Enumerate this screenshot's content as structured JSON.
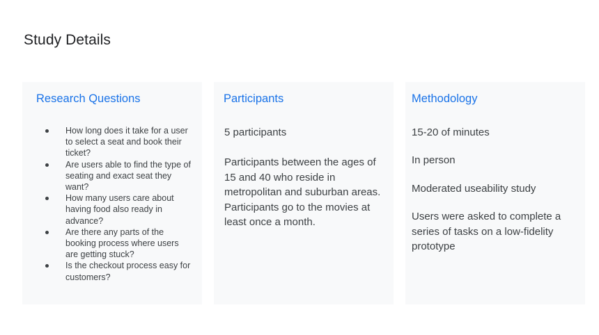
{
  "page": {
    "title": "Study Details"
  },
  "research": {
    "heading": "Research Questions",
    "questions": [
      "How long does it take for a user to select a seat and book their ticket?",
      "Are users able to find the type of seating and exact seat they want?",
      "How many users care about having food also ready in advance?",
      "Are there any parts of the booking process where users are getting stuck?",
      "Is the checkout process easy for customers?"
    ]
  },
  "participants": {
    "heading": "Participants",
    "count": "5 participants",
    "description": "Participants between the ages of 15 and 40 who reside in metropolitan and suburban areas. Participants go to the movies at least once a month."
  },
  "methodology": {
    "heading": "Methodology",
    "duration": "15-20 of minutes",
    "location": "In person",
    "type": "Moderated useability study",
    "description": "Users were asked to complete a series of tasks on a low-fidelity prototype"
  },
  "colors": {
    "heading_accent": "#1a73e8",
    "card_background": "#f8f9fa",
    "body_text": "#3c4043",
    "title_text": "#202124"
  }
}
